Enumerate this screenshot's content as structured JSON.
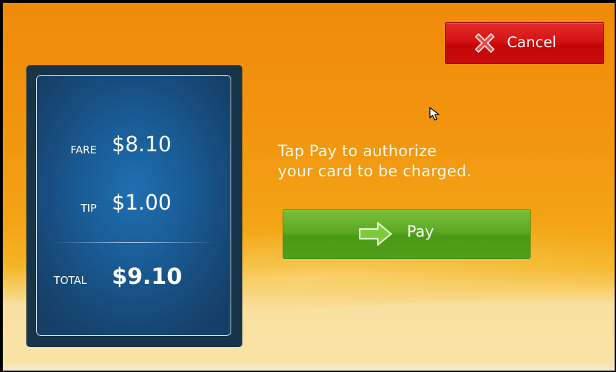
{
  "fare_panel": {
    "fare_label": "FARE",
    "fare_value": "$8.10",
    "tip_label": "TIP",
    "tip_value": "$1.00",
    "total_label": "TOTAL",
    "total_value": "$9.10"
  },
  "message": {
    "line1": "Tap Pay to authorize",
    "line2": "your card to be charged."
  },
  "buttons": {
    "pay_label": "Pay",
    "pay_icon": "arrow-right-icon",
    "cancel_label": "Cancel",
    "cancel_icon": "close-x-icon"
  },
  "colors": {
    "pay_green": "#5ca924",
    "cancel_red": "#d51414",
    "panel_blue": "#1a5d98",
    "background_orange": "#f2950f"
  }
}
